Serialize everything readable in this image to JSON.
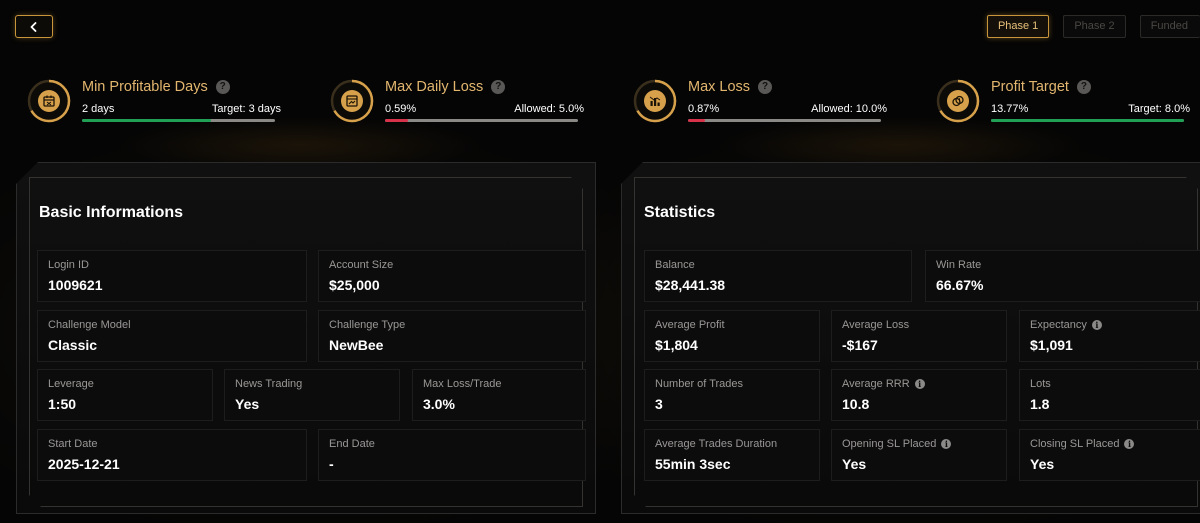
{
  "nav": {
    "back_icon": "chevron-left-icon"
  },
  "phases": [
    {
      "label": "Phase 1",
      "active": true
    },
    {
      "label": "Phase 2",
      "active": false
    },
    {
      "label": "Funded",
      "active": false
    }
  ],
  "metrics": [
    {
      "title": "Min Profitable Days",
      "icon": "calendar-icon",
      "left": "2 days",
      "right": "Target: 3 days",
      "progress": 0.67,
      "color": "#1fa055"
    },
    {
      "title": "Max Daily Loss",
      "icon": "chart-window-icon",
      "left": "0.59%",
      "right": "Allowed: 5.0%",
      "progress": 0.12,
      "color": "#d8324a"
    },
    {
      "title": "Max Loss",
      "icon": "bar-chart-icon",
      "left": "0.87%",
      "right": "Allowed: 10.0%",
      "progress": 0.09,
      "color": "#d8324a"
    },
    {
      "title": "Profit Target",
      "icon": "coins-icon",
      "left": "13.77%",
      "right": "Target: 8.0%",
      "progress": 1.0,
      "color": "#1fa055"
    }
  ],
  "basic": {
    "title": "Basic Informations",
    "login_id": {
      "label": "Login ID",
      "value": "1009621"
    },
    "account_size": {
      "label": "Account Size",
      "value": "$25,000"
    },
    "challenge_model": {
      "label": "Challenge Model",
      "value": "Classic"
    },
    "challenge_type": {
      "label": "Challenge Type",
      "value": "NewBee"
    },
    "leverage": {
      "label": "Leverage",
      "value": "1:50"
    },
    "news_trading": {
      "label": "News Trading",
      "value": "Yes"
    },
    "max_loss_trade": {
      "label": "Max Loss/Trade",
      "value": "3.0%"
    },
    "start_date": {
      "label": "Start Date",
      "value": "2025-12-21"
    },
    "end_date": {
      "label": "End Date",
      "value": "-"
    }
  },
  "stats": {
    "title": "Statistics",
    "balance": {
      "label": "Balance",
      "value": "$28,441.38"
    },
    "win_rate": {
      "label": "Win Rate",
      "value": "66.67%"
    },
    "avg_profit": {
      "label": "Average Profit",
      "value": "$1,804"
    },
    "avg_loss": {
      "label": "Average Loss",
      "value": "-$167"
    },
    "expectancy": {
      "label": "Expectancy",
      "value": "$1,091"
    },
    "num_trades": {
      "label": "Number of Trades",
      "value": "3"
    },
    "avg_rrr": {
      "label": "Average RRR",
      "value": "10.8"
    },
    "lots": {
      "label": "Lots",
      "value": "1.8"
    },
    "avg_duration": {
      "label": "Average Trades Duration",
      "value": "55min 3sec"
    },
    "opening_sl": {
      "label": "Opening SL Placed",
      "value": "Yes"
    },
    "closing_sl": {
      "label": "Closing SL Placed",
      "value": "Yes"
    }
  },
  "help_glyph": "?",
  "info_glyph": "i"
}
